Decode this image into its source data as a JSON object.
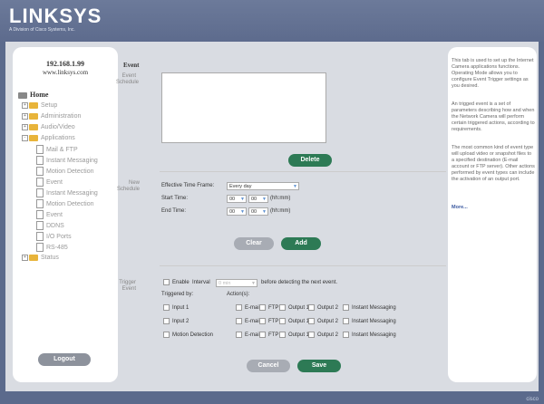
{
  "brand": {
    "logo": "LINKSYS",
    "sub": "A Division of Cisco Systems, Inc.",
    "footer": "cisco"
  },
  "left": {
    "ip": "192.168.1.99",
    "host": "www.linksys.com",
    "tree": {
      "home": "Home",
      "setup": "Setup",
      "administration": "Administration",
      "audio_video": "Audio/Video",
      "applications": "Applications",
      "mail_ftp": "Mail & FTP",
      "instant_messaging_1": "Instant Messaging",
      "motion_detection_1": "Motion Detection",
      "event_1": "Event",
      "instant_messaging_2": "Instant Messaging",
      "motion_detection_2": "Motion Detection",
      "event_2": "Event",
      "ddns": "DDNS",
      "io_ports": "I/O Ports",
      "rs485": "RS-485",
      "status": "Status"
    },
    "logout": "Logout"
  },
  "main": {
    "title": "Event",
    "event_schedule_label": "Event Schedule",
    "delete": "Delete",
    "new_schedule_label": "New Schedule",
    "effective_label": "Effective Time Frame:",
    "effective_value": "Every day",
    "start_label": "Start Time:",
    "end_label": "End Time:",
    "hh": "00",
    "mm": "00",
    "hhmm": "(hh:mm)",
    "clear": "Clear",
    "add": "Add",
    "trigger_label": "Trigger Event",
    "enable": "Enable",
    "interval": "Interval",
    "interval_value": "0 min",
    "before": "before detecting the next event.",
    "triggered_by": "Triggered by:",
    "actions": "Action(s):",
    "rows": [
      {
        "source": "Input 1"
      },
      {
        "source": "Input 2"
      },
      {
        "source": "Motion Detection"
      }
    ],
    "action_labels": {
      "email": "E-mail",
      "ftp": "FTP",
      "out1": "Output 1",
      "out2": "Output 2",
      "im": "Instant Messaging"
    },
    "cancel": "Cancel",
    "save": "Save"
  },
  "help": {
    "p1": "This tab is used to set up the Internet Camera applications functions. Operating Mode allows you to configure Event Trigger settings as you desired.",
    "p2": "An trigged event is a set of parameters describing how and when the Network Camera will perform certain triggered actions, according to requirements.",
    "p3": "The most common kind of event type will upload video or snapshot files to a specified destination (E-mail account or FTP server). Other actions performed by event types can include the activation of an output port.",
    "more": "More..."
  }
}
